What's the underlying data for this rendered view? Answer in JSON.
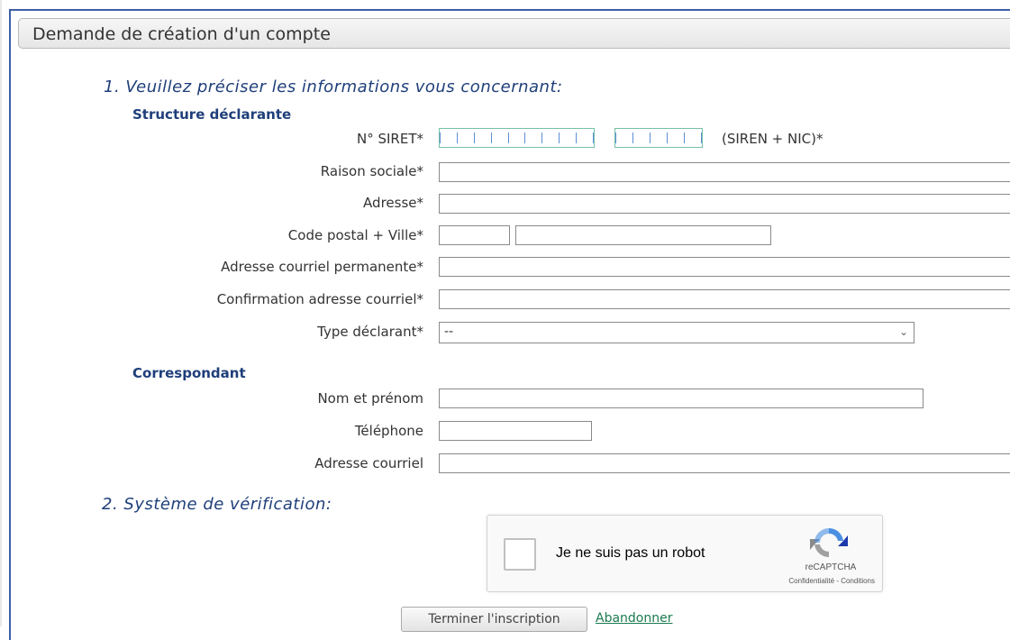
{
  "header": {
    "title": "Demande de création d'un compte"
  },
  "section1": {
    "title": "1. Veuillez préciser les informations vous concernant:",
    "structure": {
      "heading": "Structure déclarante",
      "siret_label": "N° SIRET*",
      "siret_hint": "(SIREN + NIC)*",
      "raison_sociale_label": "Raison sociale*",
      "adresse_label": "Adresse*",
      "cp_ville_label": "Code postal + Ville*",
      "courriel_label": "Adresse courriel permanente*",
      "confirmation_label": "Confirmation adresse courriel*",
      "type_label": "Type déclarant*",
      "type_value": "--"
    },
    "correspondant": {
      "heading": "Correspondant",
      "nom_label": "Nom et prénom",
      "telephone_label": "Téléphone",
      "courriel_label": "Adresse courriel"
    }
  },
  "section2": {
    "title": "2. Système de vérification:",
    "captcha": {
      "label": "Je ne suis pas un robot",
      "brand": "reCAPTCHA",
      "links": "Confidentialité - Conditions"
    }
  },
  "actions": {
    "finish_label": "Terminer l'inscription",
    "abandon_label": "Abandonner"
  },
  "colors": {
    "accent": "#1f3f7a",
    "frame": "#3d5fa8",
    "link": "#1a7a4f"
  }
}
